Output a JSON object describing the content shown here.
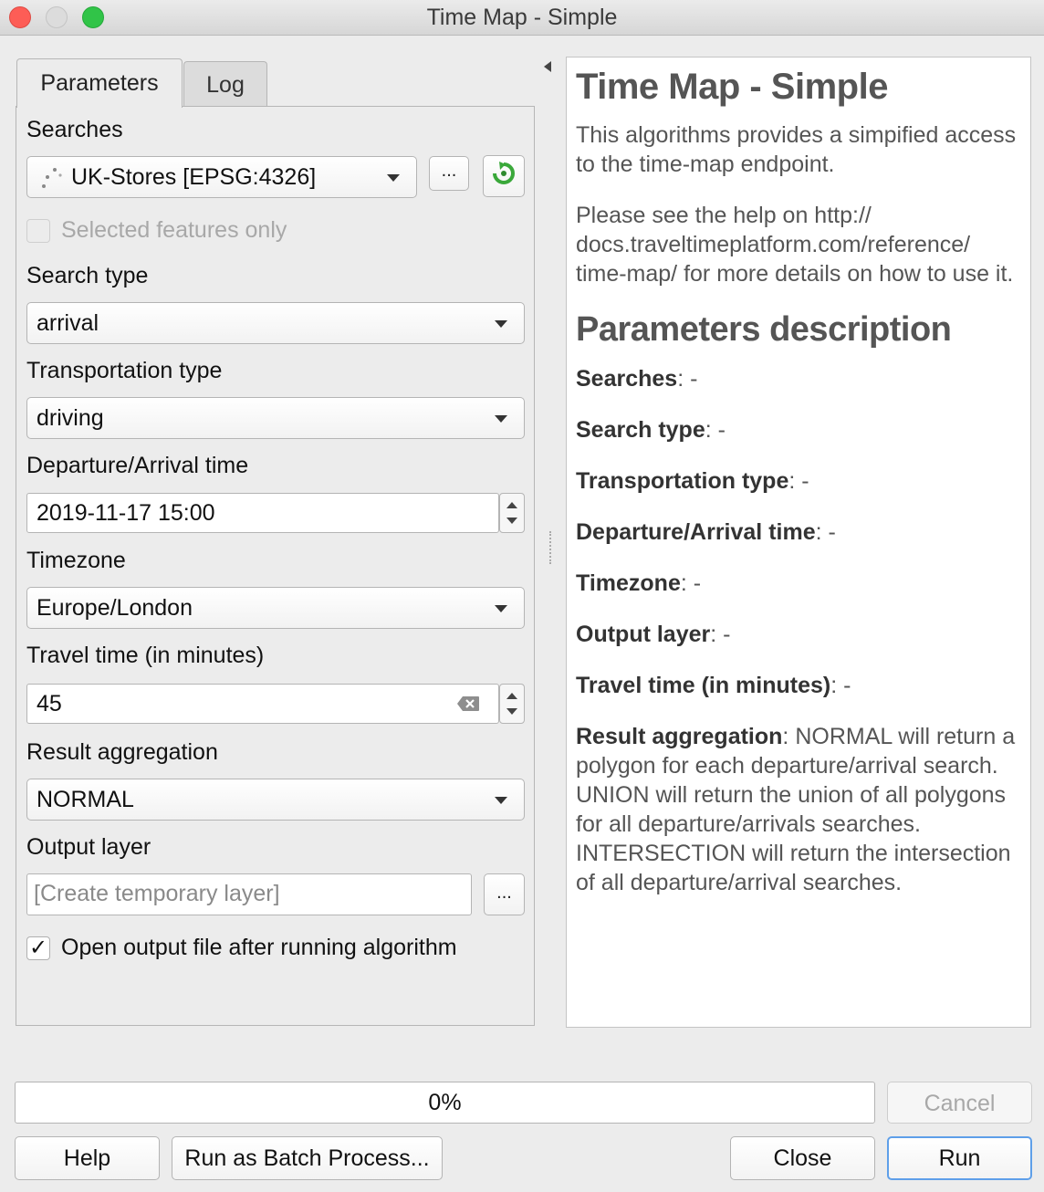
{
  "window": {
    "title": "Time Map - Simple"
  },
  "tabs": [
    {
      "label": "Parameters"
    },
    {
      "label": "Log"
    }
  ],
  "params": {
    "searches_label": "Searches",
    "searches_value": "UK-Stores [EPSG:4326]",
    "searches_browse": "...",
    "selected_only_label": "Selected features only",
    "search_type_label": "Search type",
    "search_type_value": "arrival",
    "transport_label": "Transportation type",
    "transport_value": "driving",
    "time_label": "Departure/Arrival time",
    "time_value": "2019-11-17 15:00",
    "timezone_label": "Timezone",
    "timezone_value": "Europe/London",
    "travel_time_label": "Travel time (in minutes)",
    "travel_time_value": "45",
    "aggregation_label": "Result aggregation",
    "aggregation_value": "NORMAL",
    "output_label": "Output layer",
    "output_placeholder": "[Create temporary layer]",
    "output_browse": "...",
    "open_output_label": "Open output file after running algorithm",
    "open_output_checked": true
  },
  "help": {
    "title": "Time Map - Simple",
    "intro": "This algorithms provides a simpified access to the time-map endpoint.",
    "see_help": "Please see the help on http:// docs.traveltimeplatform.com/reference/ time-map/ for more details on how to use it.",
    "params_heading": "Parameters description",
    "items": [
      {
        "name": "Searches",
        "desc": ": -"
      },
      {
        "name": "Search type",
        "desc": ": -"
      },
      {
        "name": "Transportation type",
        "desc": ": -"
      },
      {
        "name": "Departure/Arrival time",
        "desc": ": -"
      },
      {
        "name": "Timezone",
        "desc": ": -"
      },
      {
        "name": "Output layer",
        "desc": ": -"
      },
      {
        "name": "Travel time (in minutes)",
        "desc": ": -"
      },
      {
        "name": "Result aggregation",
        "desc": ": NORMAL will return a polygon for each departure/arrival search. UNION will return the union of all polygons for all departure/arrivals searches. INTERSECTION will return the intersection of all departure/arrival searches."
      }
    ]
  },
  "footer": {
    "progress": "0%",
    "cancel": "Cancel",
    "help": "Help",
    "batch": "Run as Batch Process...",
    "close": "Close",
    "run": "Run"
  },
  "colors": {
    "default_button_border": "#5e9fe9",
    "refresh_icon": "#3aa83a"
  }
}
